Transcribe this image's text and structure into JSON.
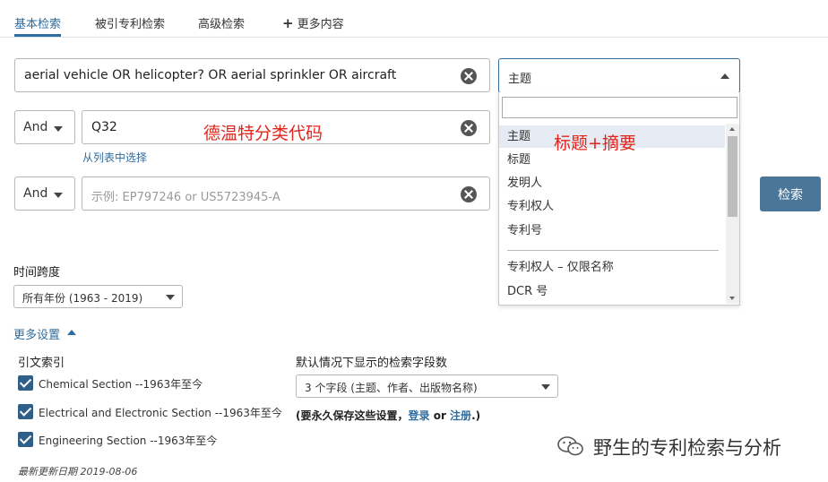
{
  "tabs": [
    {
      "label": "基本检索",
      "active": true
    },
    {
      "label": "被引专利检索",
      "active": false
    },
    {
      "label": "高级检索",
      "active": false
    },
    {
      "label": "更多内容",
      "active": false
    }
  ],
  "rows": [
    {
      "value": "aerial vehicle OR helicopter? OR aerial sprinkler   OR aircraft",
      "placeholder": ""
    },
    {
      "boolean": "And",
      "value": "Q32",
      "placeholder": "",
      "annotation": "德温特分类代码",
      "pick_link": "从列表中选择"
    },
    {
      "boolean": "And",
      "value": "",
      "placeholder": "示例: EP797246 or US5723945-A"
    }
  ],
  "field_select": {
    "selected": "主题"
  },
  "field_dropdown": {
    "search_value": "",
    "annotation": "标题+摘要",
    "options": [
      "主题",
      "标题",
      "发明人",
      "专利权人",
      "专利号"
    ],
    "options_more": [
      "专利权人 – 仅限名称",
      "DCR 号"
    ]
  },
  "search_button": "检索",
  "timespan": {
    "label": "时间跨度",
    "selected": "所有年份 (1963 - 2019)"
  },
  "more_settings": {
    "label": "更多设置"
  },
  "citation_index": {
    "label": "引文索引",
    "items": [
      {
        "label": "Chemical Section --1963年至今",
        "checked": true
      },
      {
        "label": "Electrical and Electronic Section --1963年至今",
        "checked": true
      },
      {
        "label": "Engineering Section --1963年至今",
        "checked": true
      }
    ]
  },
  "display_fields": {
    "label": "默认情况下显示的检索字段数",
    "selected": "3 个字段 (主题、作者、出版物名称)",
    "note_prefix": "(要永久保存这些设置，",
    "login": "登录",
    "or": " or ",
    "register": "注册",
    "note_suffix": ".)"
  },
  "last_updated": "最新更新日期 2019-08-06",
  "watermark": "野生的专利检索与分析",
  "colors": {
    "accent": "#2f6c9f",
    "search_button": "#4a7799",
    "checkbox": "#2f5f87",
    "annotation": "#e0261c"
  }
}
